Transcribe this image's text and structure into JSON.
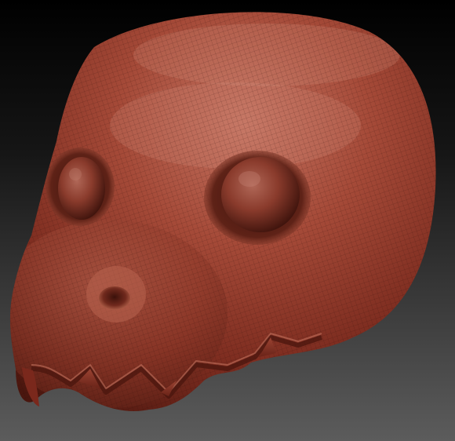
{
  "viewport": {
    "background_top": "#000000",
    "background_bottom": "#5a5a5a"
  },
  "model": {
    "description_icon": "sculpted-creature-head-icon",
    "material_base": "#8f3a2a",
    "material_highlight": "#c87660",
    "material_shadow": "#3c130c",
    "features": [
      "head",
      "left-eye",
      "right-eye",
      "nostril",
      "upper-jaw",
      "teeth"
    ],
    "display": {
      "polyframe_wireframe": true
    }
  }
}
